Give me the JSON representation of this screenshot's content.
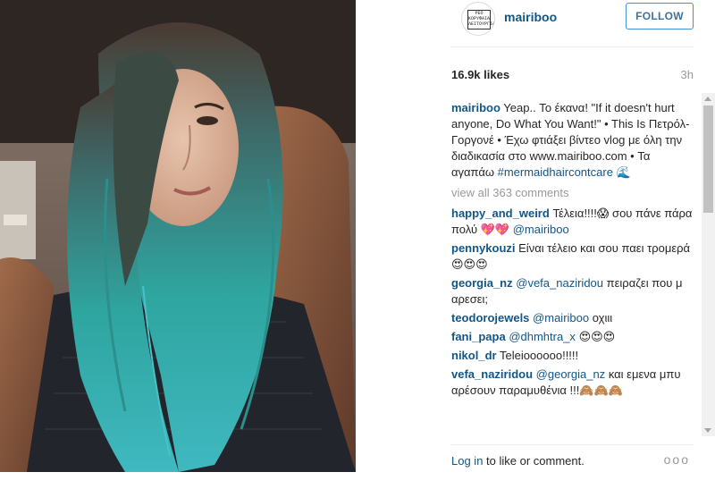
{
  "post": {
    "username": "mairiboo",
    "follow_label": "FOLLOW",
    "likes": "16.9k likes",
    "time": "3h",
    "avatar_text": "ΡΕΟ ΚΟΡΥΦΑΙΑ ΛΕΙΤΟΥΡΓΙΑ"
  },
  "caption": {
    "user": "mairiboo",
    "text": "Yeap.. Το έκανα! \"If it doesn't hurt anyone, Do What You Want!\" • This Is Πετρόλ-Γοργονέ • Έχω φτιάξει βίντεο vlog με όλη την διαδικασία στο www.mairiboo.com • Τα αγαπάω",
    "hashtag": "#mermaidhaircontcare",
    "tail": "🌊"
  },
  "view_all": "view all 363 comments",
  "comments": [
    {
      "user": "happy_and_weird",
      "text": "Τέλεια!!!!😱 σου πάνε πάρα πολύ 💖💖",
      "mention": "@mairiboo"
    },
    {
      "user": "pennykouzi",
      "text": "Είναι τέλειο και σου παει τρομερά 😍😍😍",
      "mention": ""
    },
    {
      "user": "georgia_nz",
      "text": "πειραζει που μ αρεσει;",
      "mention": "@vefa_naziridou"
    },
    {
      "user": "teodorojewels",
      "text": "οχιιι",
      "mention": "@mairiboo"
    },
    {
      "user": "fani_papa",
      "text": "😍😍😍",
      "mention": "@dhmhtra_x"
    },
    {
      "user": "nikol_dr",
      "text": "Teleioooooo!!!!!",
      "mention": ""
    },
    {
      "user": "vefa_naziridou",
      "text": "και εμενα μπυ αρέσουν παραμυθένια !!!🙈🙈🙈",
      "mention": "@georgia_nz"
    }
  ],
  "footer": {
    "login": "Log in",
    "rest": "to like or comment.",
    "more": "ooo"
  }
}
